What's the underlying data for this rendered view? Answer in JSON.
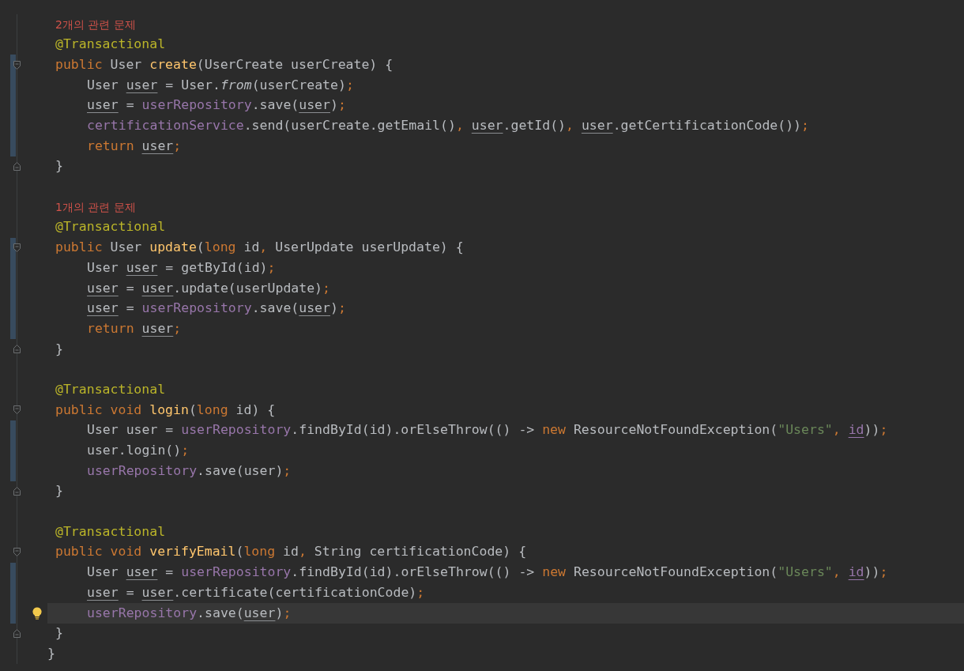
{
  "editor": {
    "members": [
      {
        "hint": "2개의 관련 문제",
        "annotation": "@Transactional",
        "signature": {
          "changed": true,
          "tokens": [
            {
              "text": "public",
              "kind": "keyword"
            },
            {
              "text": " User ",
              "kind": "plain"
            },
            {
              "text": "create",
              "kind": "decl"
            },
            {
              "text": "(UserCreate userCreate) {",
              "kind": "plain"
            }
          ]
        },
        "body": [
          {
            "changed": true,
            "tokens": [
              {
                "text": "User ",
                "kind": "plain"
              },
              {
                "text": "user",
                "kind": "local"
              },
              {
                "text": " = User.",
                "kind": "plain"
              },
              {
                "text": "from",
                "kind": "static"
              },
              {
                "text": "(userCreate)",
                "kind": "plain"
              },
              {
                "text": ";",
                "kind": "keyword"
              }
            ]
          },
          {
            "changed": true,
            "tokens": [
              {
                "text": "user",
                "kind": "local"
              },
              {
                "text": " = ",
                "kind": "plain"
              },
              {
                "text": "userRepository",
                "kind": "field"
              },
              {
                "text": ".save(",
                "kind": "plain"
              },
              {
                "text": "user",
                "kind": "local"
              },
              {
                "text": ")",
                "kind": "plain"
              },
              {
                "text": ";",
                "kind": "keyword"
              }
            ]
          },
          {
            "changed": true,
            "tokens": [
              {
                "text": "certificationService",
                "kind": "field"
              },
              {
                "text": ".send(userCreate.getEmail()",
                "kind": "plain"
              },
              {
                "text": ", ",
                "kind": "keyword"
              },
              {
                "text": "user",
                "kind": "local"
              },
              {
                "text": ".getId()",
                "kind": "plain"
              },
              {
                "text": ", ",
                "kind": "keyword"
              },
              {
                "text": "user",
                "kind": "local"
              },
              {
                "text": ".getCertificationCode())",
                "kind": "plain"
              },
              {
                "text": ";",
                "kind": "keyword"
              }
            ]
          },
          {
            "changed": true,
            "tokens": [
              {
                "text": "return ",
                "kind": "keyword"
              },
              {
                "text": "user",
                "kind": "local"
              },
              {
                "text": ";",
                "kind": "keyword"
              }
            ]
          }
        ],
        "closing": "}"
      },
      {
        "hint": "1개의 관련 문제",
        "annotation": "@Transactional",
        "signature": {
          "changed": true,
          "tokens": [
            {
              "text": "public",
              "kind": "keyword"
            },
            {
              "text": " User ",
              "kind": "plain"
            },
            {
              "text": "update",
              "kind": "decl"
            },
            {
              "text": "(",
              "kind": "plain"
            },
            {
              "text": "long",
              "kind": "keyword"
            },
            {
              "text": " id",
              "kind": "plain"
            },
            {
              "text": ",",
              "kind": "keyword"
            },
            {
              "text": " UserUpdate userUpdate) {",
              "kind": "plain"
            }
          ]
        },
        "body": [
          {
            "changed": true,
            "tokens": [
              {
                "text": "User ",
                "kind": "plain"
              },
              {
                "text": "user",
                "kind": "local"
              },
              {
                "text": " = getById(id)",
                "kind": "plain"
              },
              {
                "text": ";",
                "kind": "keyword"
              }
            ]
          },
          {
            "changed": true,
            "tokens": [
              {
                "text": "user",
                "kind": "local"
              },
              {
                "text": " = ",
                "kind": "plain"
              },
              {
                "text": "user",
                "kind": "local"
              },
              {
                "text": ".update(userUpdate)",
                "kind": "plain"
              },
              {
                "text": ";",
                "kind": "keyword"
              }
            ]
          },
          {
            "changed": true,
            "tokens": [
              {
                "text": "user",
                "kind": "local"
              },
              {
                "text": " = ",
                "kind": "plain"
              },
              {
                "text": "userRepository",
                "kind": "field"
              },
              {
                "text": ".save(",
                "kind": "plain"
              },
              {
                "text": "user",
                "kind": "local"
              },
              {
                "text": ")",
                "kind": "plain"
              },
              {
                "text": ";",
                "kind": "keyword"
              }
            ]
          },
          {
            "changed": true,
            "tokens": [
              {
                "text": "return ",
                "kind": "keyword"
              },
              {
                "text": "user",
                "kind": "local"
              },
              {
                "text": ";",
                "kind": "keyword"
              }
            ]
          }
        ],
        "closing": "}"
      },
      {
        "annotation": "@Transactional",
        "signature": {
          "changed": false,
          "tokens": [
            {
              "text": "public void ",
              "kind": "keyword"
            },
            {
              "text": "login",
              "kind": "decl"
            },
            {
              "text": "(",
              "kind": "plain"
            },
            {
              "text": "long",
              "kind": "keyword"
            },
            {
              "text": " id) {",
              "kind": "plain"
            }
          ]
        },
        "body": [
          {
            "changed": true,
            "tokens": [
              {
                "text": "User user = ",
                "kind": "plain"
              },
              {
                "text": "userRepository",
                "kind": "field"
              },
              {
                "text": ".findById(id).orElseThrow(() -> ",
                "kind": "plain"
              },
              {
                "text": "new",
                "kind": "keyword"
              },
              {
                "text": " ResourceNotFoundException(",
                "kind": "plain"
              },
              {
                "text": "\"Users\"",
                "kind": "string"
              },
              {
                "text": ", ",
                "kind": "keyword"
              },
              {
                "text": "id",
                "kind": "captured"
              },
              {
                "text": "))",
                "kind": "plain"
              },
              {
                "text": ";",
                "kind": "keyword"
              }
            ]
          },
          {
            "changed": true,
            "tokens": [
              {
                "text": "user.login()",
                "kind": "plain"
              },
              {
                "text": ";",
                "kind": "keyword"
              }
            ]
          },
          {
            "changed": true,
            "tokens": [
              {
                "text": "userRepository",
                "kind": "field"
              },
              {
                "text": ".save(user)",
                "kind": "plain"
              },
              {
                "text": ";",
                "kind": "keyword"
              }
            ]
          }
        ],
        "closing": "}"
      },
      {
        "annotation": "@Transactional",
        "signature": {
          "changed": false,
          "tokens": [
            {
              "text": "public void ",
              "kind": "keyword"
            },
            {
              "text": "verifyEmail",
              "kind": "decl"
            },
            {
              "text": "(",
              "kind": "plain"
            },
            {
              "text": "long",
              "kind": "keyword"
            },
            {
              "text": " id",
              "kind": "plain"
            },
            {
              "text": ",",
              "kind": "keyword"
            },
            {
              "text": " String certificationCode) {",
              "kind": "plain"
            }
          ]
        },
        "body": [
          {
            "changed": true,
            "tokens": [
              {
                "text": "User ",
                "kind": "plain"
              },
              {
                "text": "user",
                "kind": "local"
              },
              {
                "text": " = ",
                "kind": "plain"
              },
              {
                "text": "userRepository",
                "kind": "field"
              },
              {
                "text": ".findById(id).orElseThrow(() -> ",
                "kind": "plain"
              },
              {
                "text": "new",
                "kind": "keyword"
              },
              {
                "text": " ResourceNotFoundException(",
                "kind": "plain"
              },
              {
                "text": "\"Users\"",
                "kind": "string"
              },
              {
                "text": ", ",
                "kind": "keyword"
              },
              {
                "text": "id",
                "kind": "captured"
              },
              {
                "text": "))",
                "kind": "plain"
              },
              {
                "text": ";",
                "kind": "keyword"
              }
            ]
          },
          {
            "changed": true,
            "tokens": [
              {
                "text": "user",
                "kind": "local"
              },
              {
                "text": " = ",
                "kind": "plain"
              },
              {
                "text": "user",
                "kind": "local"
              },
              {
                "text": ".certificate(certificationCode)",
                "kind": "plain"
              },
              {
                "text": ";",
                "kind": "keyword"
              }
            ]
          },
          {
            "changed": true,
            "current": true,
            "bulb": true,
            "tokens": [
              {
                "text": "userRepository",
                "kind": "field"
              },
              {
                "text": ".save(",
                "kind": "plain"
              },
              {
                "text": "user",
                "kind": "local"
              },
              {
                "text": ")",
                "kind": "plain"
              },
              {
                "text": ";",
                "kind": "keyword"
              }
            ]
          }
        ],
        "closing": "}"
      }
    ],
    "closing": "}"
  }
}
